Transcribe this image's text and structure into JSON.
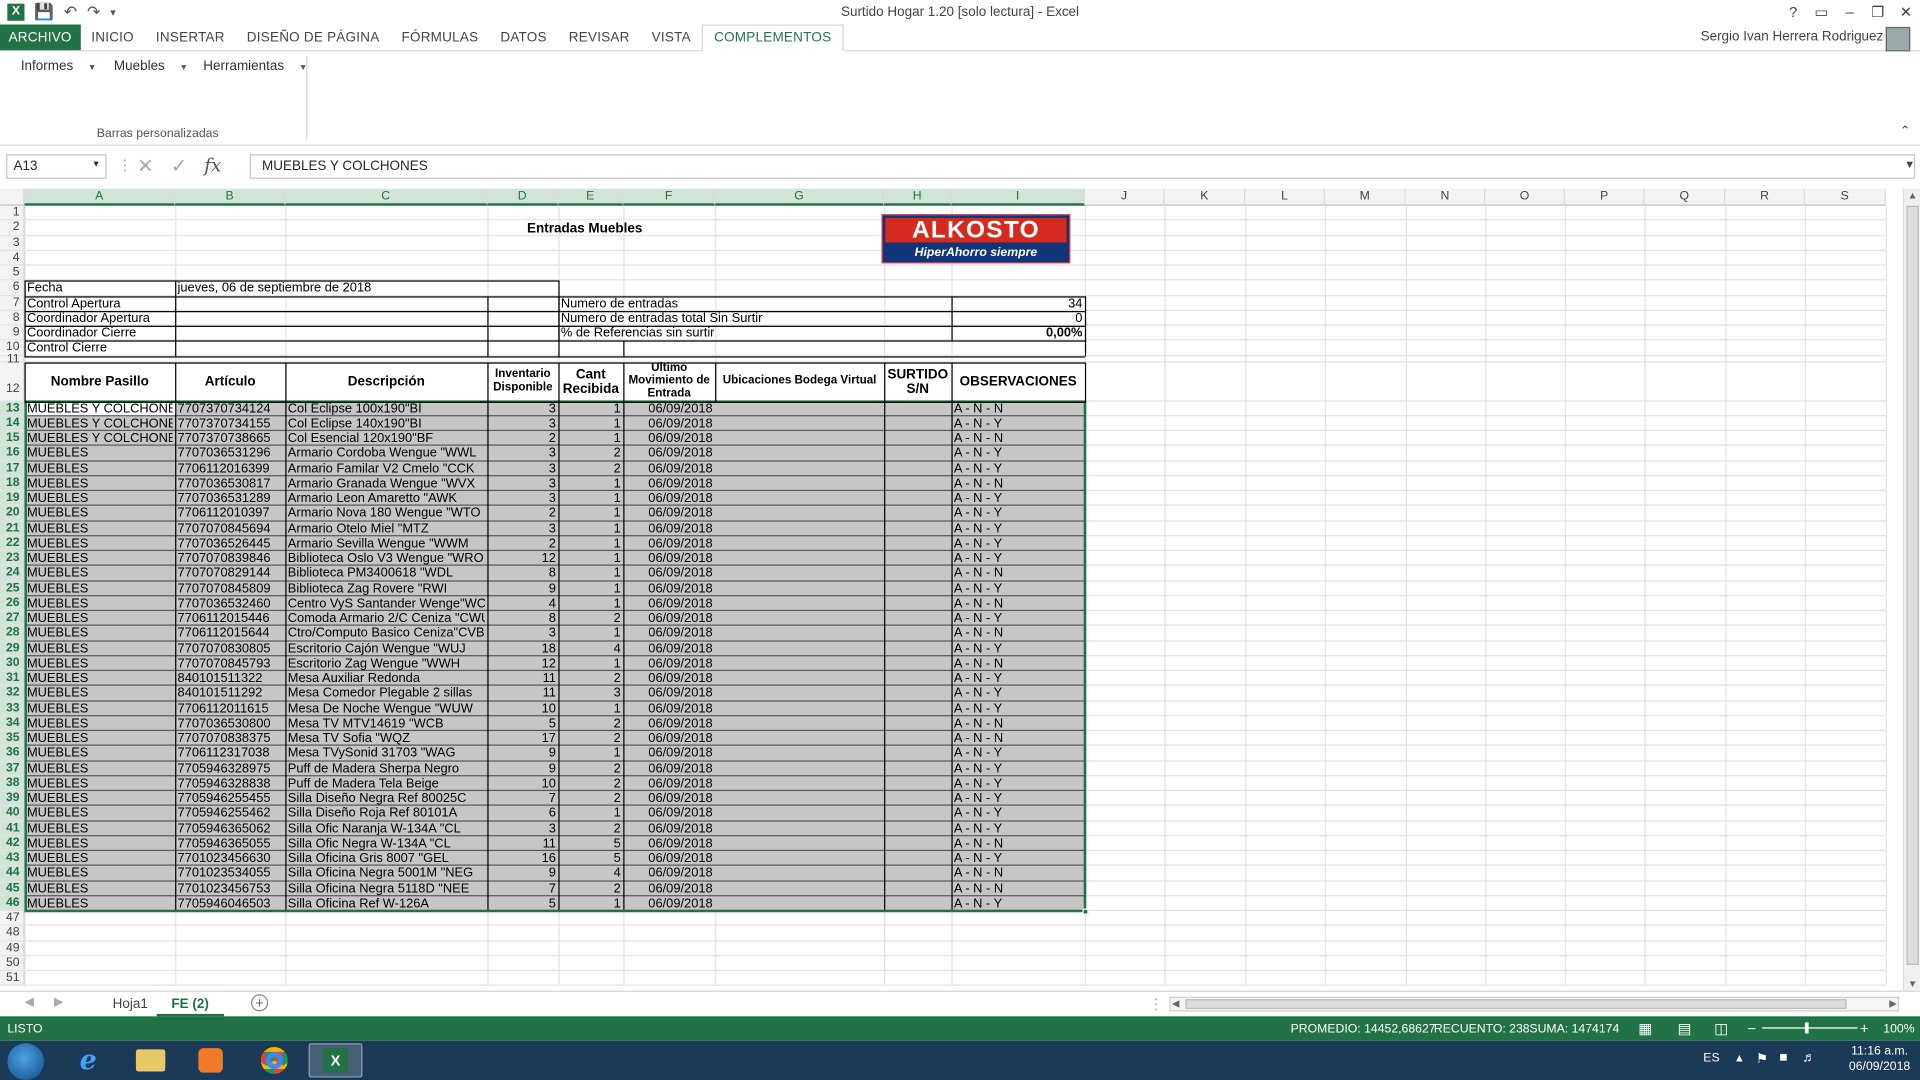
{
  "window": {
    "title": "Surtido Hogar 1.20  [solo lectura] - Excel",
    "controls": [
      "?",
      "▭",
      "–",
      "❐",
      "✕"
    ]
  },
  "ribbon": {
    "tabs": [
      "ARCHIVO",
      "INICIO",
      "INSERTAR",
      "DISEÑO DE PÁGINA",
      "FÓRMULAS",
      "DATOS",
      "REVISAR",
      "VISTA",
      "COMPLEMENTOS"
    ],
    "active_tab": "COMPLEMENTOS",
    "user": "Sergio Ivan Herrera Rodriguez",
    "buttons": [
      "Informes",
      "Muebles",
      "Herramientas"
    ],
    "group_label": "Barras personalizadas"
  },
  "formula_bar": {
    "name_box": "A13",
    "formula": "MUEBLES Y COLCHONES"
  },
  "columns": [
    "A",
    "B",
    "C",
    "D",
    "E",
    "F",
    "G",
    "H",
    "I",
    "J",
    "K",
    "L",
    "M",
    "N",
    "O",
    "P",
    "Q",
    "R",
    "S"
  ],
  "sheet": {
    "title": "Entradas Muebles",
    "logo": {
      "brand": "ALKOSTO",
      "tagline": "HiperAhorro siempre"
    },
    "info_left": [
      {
        "label": "Fecha",
        "value": "jueves, 06 de septiembre de 2018"
      },
      {
        "label": "Control Apertura",
        "value": ""
      },
      {
        "label": "Coordinador Apertura",
        "value": ""
      },
      {
        "label": "Coordinador Cierre",
        "value": ""
      },
      {
        "label": "Control Cierre",
        "value": ""
      }
    ],
    "info_right": [
      {
        "label": "Numero de entradas",
        "value": "34"
      },
      {
        "label": "Numero de entradas  total Sin Surtir",
        "value": "0"
      },
      {
        "label": "% de Referencias sin surtir",
        "value": "0,00%"
      }
    ],
    "headers": [
      "Nombre Pasillo",
      "Artículo",
      "Descripción",
      "Inventario Disponible",
      "Cant Recibida",
      "Ultimo Movimiento de Entrada",
      "Ubicaciones Bodega Virtual",
      "SURTIDO S/N",
      "OBSERVACIONES"
    ],
    "rows": [
      [
        "MUEBLES Y COLCHONES",
        "7707370734124",
        "Col Eclipse 100x190\"BI",
        "3",
        "1",
        "06/09/2018",
        "A - N - N"
      ],
      [
        "MUEBLES Y COLCHONES",
        "7707370734155",
        "Col Eclipse 140x190\"BI",
        "3",
        "1",
        "06/09/2018",
        "A - N - Y"
      ],
      [
        "MUEBLES Y COLCHONES",
        "7707370738665",
        "Col Esencial 120x190\"BF",
        "2",
        "1",
        "06/09/2018",
        "A - N - N"
      ],
      [
        "MUEBLES",
        "7707036531296",
        "Armario Cordoba Wengue \"WWL",
        "3",
        "2",
        "06/09/2018",
        "A - N - Y"
      ],
      [
        "MUEBLES",
        "7706112016399",
        "Armario Familar V2 Cmelo \"CCK",
        "3",
        "2",
        "06/09/2018",
        "A - N - Y"
      ],
      [
        "MUEBLES",
        "7707036530817",
        "Armario Granada Wengue \"WVX",
        "3",
        "1",
        "06/09/2018",
        "A - N - N"
      ],
      [
        "MUEBLES",
        "7707036531289",
        "Armario Leon Amaretto \"AWK",
        "3",
        "1",
        "06/09/2018",
        "A - N - Y"
      ],
      [
        "MUEBLES",
        "7706112010397",
        "Armario Nova 180 Wengue \"WTO",
        "2",
        "1",
        "06/09/2018",
        "A - N - Y"
      ],
      [
        "MUEBLES",
        "7707070845694",
        "Armario Otelo Miel \"MTZ",
        "3",
        "1",
        "06/09/2018",
        "A - N - Y"
      ],
      [
        "MUEBLES",
        "7707036526445",
        "Armario Sevilla Wengue \"WWM",
        "2",
        "1",
        "06/09/2018",
        "A - N - Y"
      ],
      [
        "MUEBLES",
        "7707070839846",
        "Biblioteca Oslo V3 Wengue \"WRO",
        "12",
        "1",
        "06/09/2018",
        "A - N - Y"
      ],
      [
        "MUEBLES",
        "7707070829144",
        "Biblioteca PM3400618 \"WDL",
        "8",
        "1",
        "06/09/2018",
        "A - N - N"
      ],
      [
        "MUEBLES",
        "7707070845809",
        "Biblioteca Zag Rovere \"RWI",
        "9",
        "1",
        "06/09/2018",
        "A - N - Y"
      ],
      [
        "MUEBLES",
        "7707036532460",
        "Centro VyS Santander Wenge\"WCY",
        "4",
        "1",
        "06/09/2018",
        "A - N - N"
      ],
      [
        "MUEBLES",
        "7706112015446",
        "Comoda Armario 2/C Ceniza \"CWU",
        "8",
        "2",
        "06/09/2018",
        "A - N - Y"
      ],
      [
        "MUEBLES",
        "7706112015644",
        "Ctro/Computo Basico Ceniza\"CVB",
        "3",
        "1",
        "06/09/2018",
        "A - N - N"
      ],
      [
        "MUEBLES",
        "7707070830805",
        "Escritorio Cajón Wengue \"WUJ",
        "18",
        "4",
        "06/09/2018",
        "A - N - Y"
      ],
      [
        "MUEBLES",
        "7707070845793",
        "Escritorio Zag Wengue \"WWH",
        "12",
        "1",
        "06/09/2018",
        "A - N - N"
      ],
      [
        "MUEBLES",
        "840101511322",
        "Mesa Auxiliar Redonda",
        "11",
        "2",
        "06/09/2018",
        "A - N - Y"
      ],
      [
        "MUEBLES",
        "840101511292",
        "Mesa Comedor Plegable 2 sillas",
        "11",
        "3",
        "06/09/2018",
        "A - N - Y"
      ],
      [
        "MUEBLES",
        "7706112011615",
        "Mesa De Noche Wengue \"WUW",
        "10",
        "1",
        "06/09/2018",
        "A - N - Y"
      ],
      [
        "MUEBLES",
        "7707036530800",
        "Mesa TV MTV14619  \"WCB",
        "5",
        "2",
        "06/09/2018",
        "A - N - N"
      ],
      [
        "MUEBLES",
        "7707070838375",
        "Mesa TV Sofia \"WQZ",
        "17",
        "2",
        "06/09/2018",
        "A - N - N"
      ],
      [
        "MUEBLES",
        "7706112317038",
        "Mesa TVySonid 31703 \"WAG",
        "9",
        "1",
        "06/09/2018",
        "A - N - Y"
      ],
      [
        "MUEBLES",
        "7705946328975",
        "Puff de Madera Sherpa Negro",
        "9",
        "2",
        "06/09/2018",
        "A - N - Y"
      ],
      [
        "MUEBLES",
        "7705946328838",
        "Puff de Madera Tela Beige",
        "10",
        "2",
        "06/09/2018",
        "A - N - Y"
      ],
      [
        "MUEBLES",
        "7705946255455",
        "Silla Diseño Negra Ref 80025C",
        "7",
        "2",
        "06/09/2018",
        "A - N - Y"
      ],
      [
        "MUEBLES",
        "7705946255462",
        "Silla Diseño Roja Ref 80101A",
        "6",
        "1",
        "06/09/2018",
        "A - N - Y"
      ],
      [
        "MUEBLES",
        "7705946365062",
        "Silla Ofic Naranja W-134A \"CL",
        "3",
        "2",
        "06/09/2018",
        "A - N - Y"
      ],
      [
        "MUEBLES",
        "7705946365055",
        "Silla Ofic Negra W-134A \"CL",
        "11",
        "5",
        "06/09/2018",
        "A - N - N"
      ],
      [
        "MUEBLES",
        "7701023456630",
        "Silla Oficina Gris 8007 \"GEL",
        "16",
        "5",
        "06/09/2018",
        "A - N - Y"
      ],
      [
        "MUEBLES",
        "7701023534055",
        "Silla Oficina Negra 5001M \"NEG",
        "9",
        "4",
        "06/09/2018",
        "A - N - N"
      ],
      [
        "MUEBLES",
        "7701023456753",
        "Silla Oficina Negra 5118D \"NEE",
        "7",
        "2",
        "06/09/2018",
        "A - N - N"
      ],
      [
        "MUEBLES",
        "7705946046503",
        "Silla Oficina Ref W-126A",
        "5",
        "1",
        "06/09/2018",
        "A - N - Y"
      ]
    ]
  },
  "sheet_tabs": [
    "Hoja1",
    "FE (2)"
  ],
  "active_sheet": "FE (2)",
  "status": {
    "mode": "LISTO",
    "promedio": "PROMEDIO: 14452,68627",
    "recuento": "RECUENTO: 238",
    "suma": "SUMA: 1474174",
    "zoom": "100%"
  },
  "taskbar": {
    "lang": "ES",
    "time": "11:16 a.m.",
    "date": "06/09/2018"
  },
  "colors": {
    "excel_green": "#217346",
    "selection_fill": "#c6c6c6"
  }
}
